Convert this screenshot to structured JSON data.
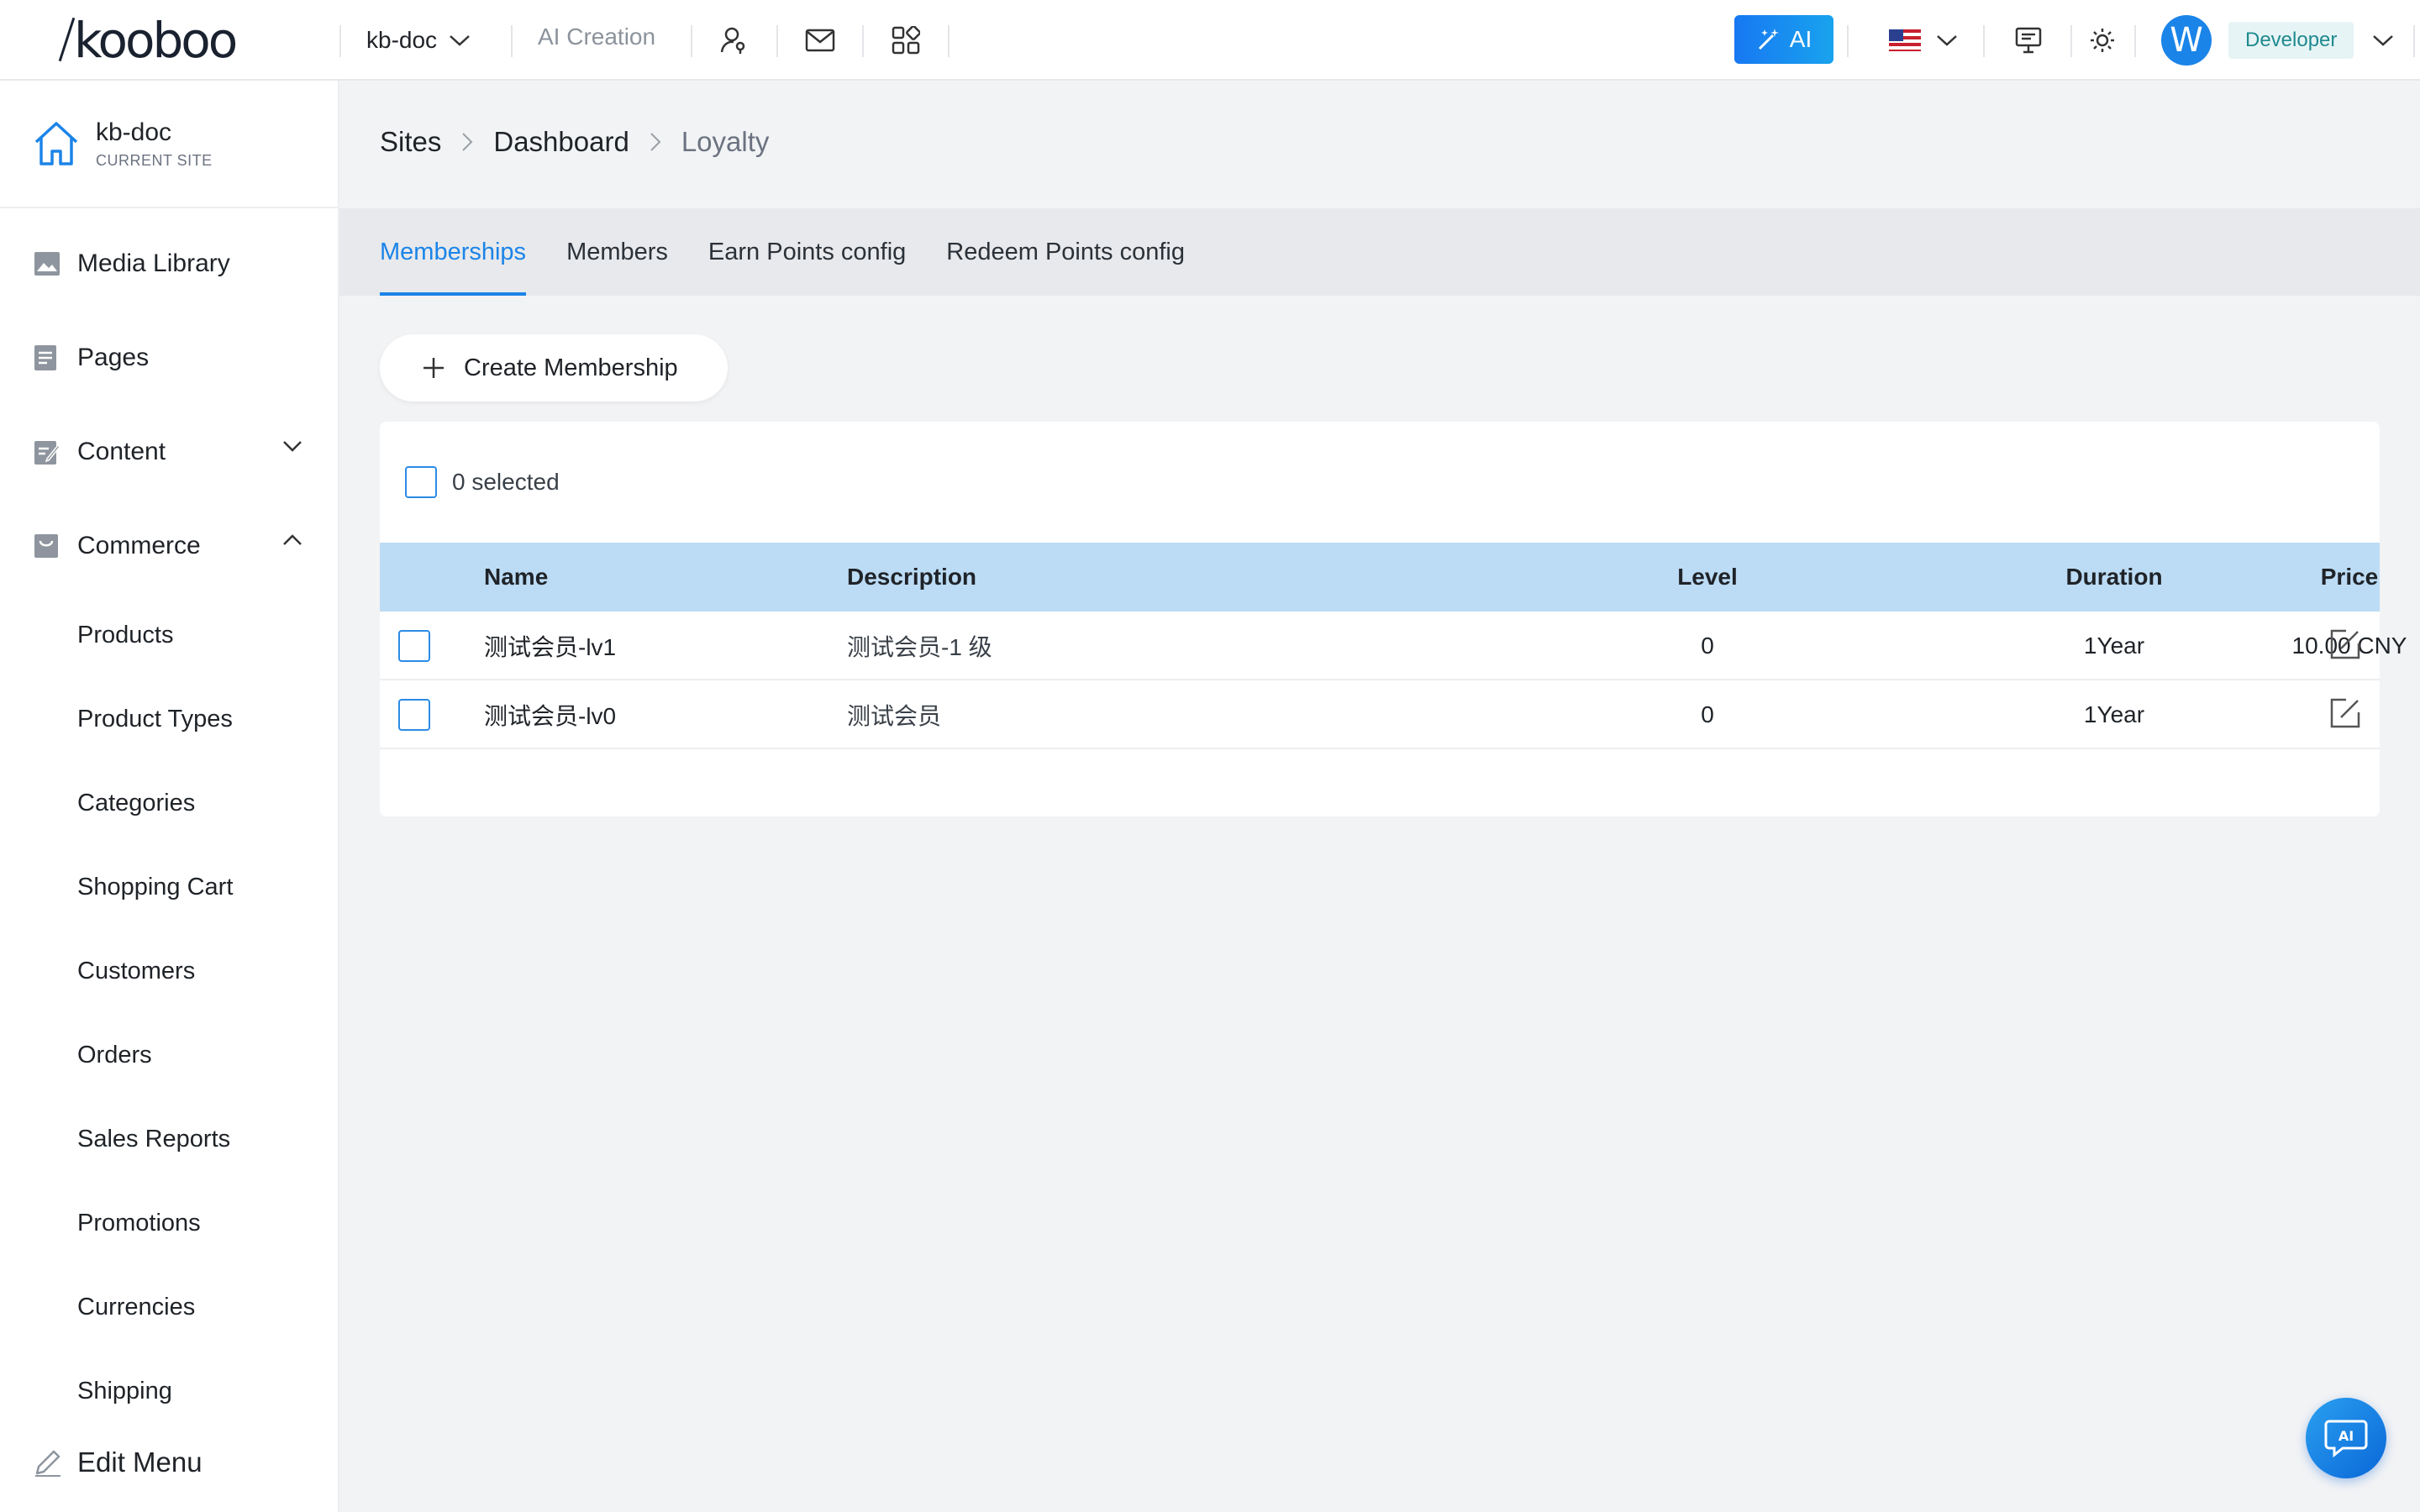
{
  "topbar": {
    "logo": "kooboo",
    "site_name": "kb-doc",
    "ai_creation": "AI Creation",
    "ai_button": "AI",
    "avatar_initial": "W",
    "role": "Developer"
  },
  "sidebar": {
    "current_site_name": "kb-doc",
    "current_site_label": "CURRENT SITE",
    "items": [
      {
        "label": "Media Library",
        "icon": "image-icon"
      },
      {
        "label": "Pages",
        "icon": "page-icon"
      },
      {
        "label": "Content",
        "icon": "content-icon",
        "expanded": false
      },
      {
        "label": "Commerce",
        "icon": "cart-icon",
        "expanded": true
      }
    ],
    "commerce_sub": [
      "Products",
      "Product Types",
      "Categories",
      "Shopping Cart",
      "Customers",
      "Orders",
      "Sales Reports",
      "Promotions",
      "Currencies",
      "Shipping"
    ],
    "edit_menu": "Edit Menu"
  },
  "breadcrumb": [
    "Sites",
    "Dashboard",
    "Loyalty"
  ],
  "tabs": [
    "Memberships",
    "Members",
    "Earn Points config",
    "Redeem Points config"
  ],
  "active_tab": "Memberships",
  "create_button": "Create Membership",
  "selection": "0 selected",
  "table": {
    "columns": [
      "Name",
      "Description",
      "Level",
      "Duration",
      "Price"
    ],
    "rows": [
      {
        "name": "测试会员-lv1",
        "description": "测试会员-1 级",
        "level": "0",
        "duration": "1Year",
        "price": "10.00 CNY"
      },
      {
        "name": "测试会员-lv0",
        "description": "测试会员",
        "level": "0",
        "duration": "1Year",
        "price": ""
      }
    ]
  },
  "colors": {
    "accent": "#1b84e8",
    "table_header": "#bcdcf5",
    "role_badge_text": "#1f8a8f"
  }
}
